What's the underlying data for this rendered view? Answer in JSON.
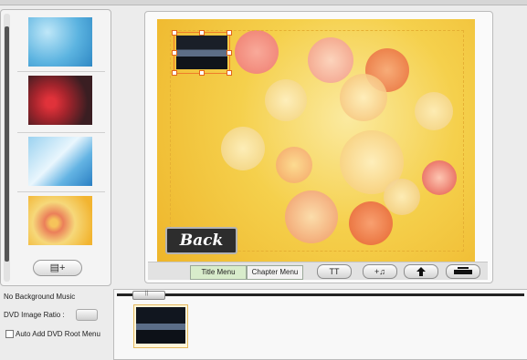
{
  "left_panel": {
    "thumbnails": [
      {
        "name": "blue-background-thumb"
      },
      {
        "name": "red-roses-background-thumb"
      },
      {
        "name": "blue-light-background-thumb"
      },
      {
        "name": "yellow-flowers-background-thumb"
      }
    ],
    "add_button_icon": "add-background-icon"
  },
  "preview": {
    "back_button": "Back",
    "tabs": [
      "Title Menu",
      "Chapter Menu"
    ],
    "active_tab": "Title Menu",
    "tools": [
      {
        "label": "TT",
        "icon": "text-icon"
      },
      {
        "label": "+♫",
        "icon": "add-music-icon"
      },
      {
        "label": "",
        "icon": "arrow-up-icon"
      },
      {
        "label": "",
        "icon": "frame-icon"
      }
    ]
  },
  "options": {
    "music": "No Background Music",
    "ratio_label": "DVD Image Ratio :",
    "auto_menu_label": "Auto Add DVD Root Menu",
    "auto_menu_checked": false
  },
  "timeline": {
    "slider_label": "||"
  },
  "colors": {
    "selection": "#ef7d2a",
    "active_tab_bg": "#d8eccb",
    "canvas_bg": "#f5d04c"
  }
}
